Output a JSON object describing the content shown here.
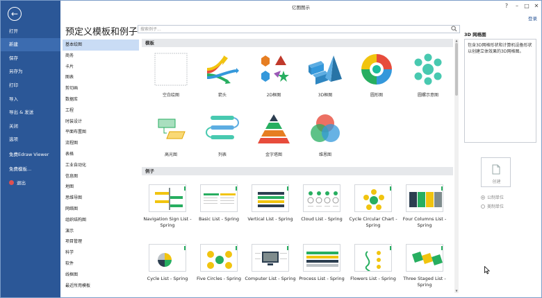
{
  "window": {
    "title": "亿图图示",
    "login": "登录"
  },
  "nav": {
    "back_glyph": "←",
    "items": [
      {
        "label": "打开"
      },
      {
        "label": "新建"
      },
      {
        "label": "保存"
      },
      {
        "label": "另存为"
      },
      {
        "label": "打印"
      },
      {
        "label": "导入"
      },
      {
        "label": "导出 & 发送"
      },
      {
        "label": "关闭"
      },
      {
        "label": "选项"
      },
      {
        "label": "免费Edraw Viewer"
      },
      {
        "label": "免费模板..."
      },
      {
        "label": "退出"
      }
    ],
    "active_index": 1
  },
  "main": {
    "heading": "预定义模板和例子",
    "search_placeholder": "搜索例子..."
  },
  "categories": [
    "基本绘图",
    "商务",
    "卡片",
    "图表",
    "剪切画",
    "数据库",
    "工程",
    "时装设计",
    "平面布置图",
    "流程图",
    "表格",
    "工业自动化",
    "信息图",
    "地图",
    "思维导图",
    "网络图",
    "组织结构图",
    "演示",
    "项目管理",
    "科学",
    "软件",
    "线框图",
    "最近所用模板"
  ],
  "sections": {
    "templates": "模板",
    "examples": "例子"
  },
  "templates": [
    {
      "label": "空白绘图",
      "icon": "blank-canvas-icon"
    },
    {
      "label": "箭头",
      "icon": "arrows-icon"
    },
    {
      "label": "2D框图",
      "icon": "2d-shapes-icon"
    },
    {
      "label": "3D框图",
      "icon": "3d-shapes-icon"
    },
    {
      "label": "圆形图",
      "icon": "circle-chart-icon"
    },
    {
      "label": "圆螺示意图",
      "icon": "circle-spoke-icon"
    },
    {
      "label": "高光图",
      "icon": "highlight-icon"
    },
    {
      "label": "列表",
      "icon": "list-icon"
    },
    {
      "label": "金字塔图",
      "icon": "pyramid-icon"
    },
    {
      "label": "维恩图",
      "icon": "venn-icon"
    }
  ],
  "examples": [
    {
      "label": "Navigation Sign List - Spring"
    },
    {
      "label": "Basic List - Spring"
    },
    {
      "label": "Vertical List - Spring"
    },
    {
      "label": "Cloud List - Spring"
    },
    {
      "label": "Cycle Circular Chart - Spring"
    },
    {
      "label": "Four Columns List - Spring"
    },
    {
      "label": "Cycle List - Spring"
    },
    {
      "label": "Five Circles - Spring"
    },
    {
      "label": "Computer List - Spring"
    },
    {
      "label": "Process List - Spring"
    },
    {
      "label": "Flowers List - Spring"
    },
    {
      "label": "Three Staged List - Spring"
    }
  ],
  "right_panel": {
    "title": "3D 网格图",
    "description": "包含3D网格形状和计算机设备形状以创建立体效果的3D网格图。",
    "create_label": "创建",
    "units": [
      {
        "label": "公制单位"
      },
      {
        "label": "美制单位"
      }
    ]
  },
  "colors": {
    "nav_bg": "#2b5797",
    "nav_active": "#3c6cb0",
    "category_active": "#c9dcf5"
  }
}
